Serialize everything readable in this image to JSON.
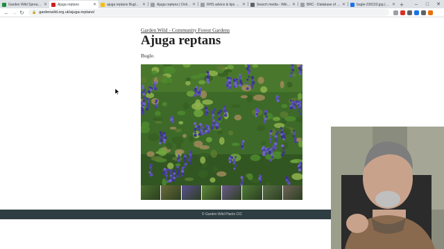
{
  "browser": {
    "tabs": [
      {
        "title": "Garden Wild Spreadsheet",
        "favicon_color": "#1e8e3e",
        "active": false
      },
      {
        "title": "Ajuga reptans",
        "favicon_color": "#c5221f",
        "active": true
      },
      {
        "title": "ajuga reptans Bugle, Dom...",
        "favicon_color": "#fbbc04",
        "active": false
      },
      {
        "title": "Ajuga reptans | Online Atl...",
        "favicon_color": "#9aa0a6",
        "active": false
      },
      {
        "title": "RHS advice & tips on gar...",
        "favicon_color": "#9aa0a6",
        "active": false
      },
      {
        "title": "Search media - Wikimedi...",
        "favicon_color": "#5f6368",
        "active": false
      },
      {
        "title": "BRC - Database of insect...",
        "favicon_color": "#9aa0a6",
        "active": false
      },
      {
        "title": "bugle-236153.jpg (7200×...",
        "favicon_color": "#1a73e8",
        "active": false
      }
    ],
    "new_tab_label": "+",
    "window_controls": {
      "minimize": "–",
      "maximize": "□",
      "close": "✕"
    },
    "nav": {
      "back": "←",
      "forward": "→",
      "reload": "↻",
      "home": "⌂"
    },
    "url": "gardenwild.org.uk/ajuga-reptans/",
    "extension_colors": [
      "#9aa0a6",
      "#d93025",
      "#5f6368",
      "#1a73e8",
      "#5f6368",
      "#e8710a"
    ]
  },
  "page": {
    "breadcrumb": "Garden Wild - Community Forest Gardens",
    "title": "Ajuga reptans",
    "common_name": "Bugle.",
    "thumbnail_count": 8,
    "footer": "© Garden Wild Plants CIC"
  },
  "icons": {
    "lock": "lock-icon",
    "cursor": "mouse-cursor-icon"
  }
}
